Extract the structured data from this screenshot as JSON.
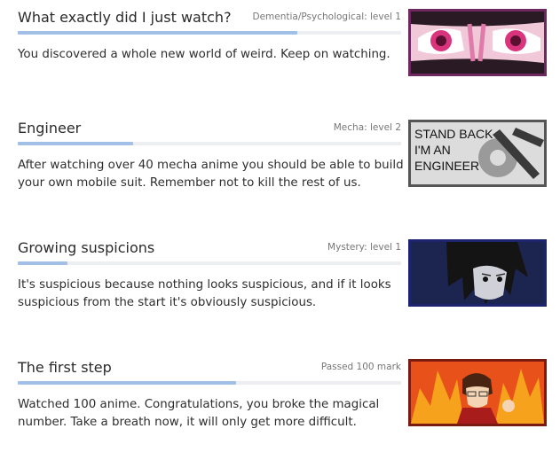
{
  "achievements": [
    {
      "title": "What exactly did I just watch?",
      "category": "Dementia/Psychological: level 1",
      "description": "You discovered a whole new world of weird. Keep on watching.",
      "progress": 0.73,
      "border_color": "#6e2860",
      "icon": "dementia-eyes-badge"
    },
    {
      "title": "Engineer",
      "category": "Mecha: level 2",
      "description": "After watching over 40 mecha anime you should be able to build your own mobile suit. Remember not to kill the rest of us.",
      "progress": 0.3,
      "border_color": "#555555",
      "icon": "engineer-badge",
      "badge_text": [
        "STAND BACK",
        "I'M AN",
        "ENGINEER"
      ]
    },
    {
      "title": "Growing suspicions",
      "category": "Mystery: level 1",
      "description": "It's suspicious because nothing looks suspicious, and if it looks suspicious from the start it's obviously suspicious.",
      "progress": 0.13,
      "border_color": "#1c2470",
      "icon": "mystery-detective-badge"
    },
    {
      "title": "The first step",
      "category": "Passed 100 mark",
      "description": "Watched 100 anime. Congratulations, you broke the magical number. Take a breath now, it will only get more difficult.",
      "progress": 0.57,
      "border_color": "#7a1a10",
      "icon": "first-step-fire-badge"
    }
  ]
}
